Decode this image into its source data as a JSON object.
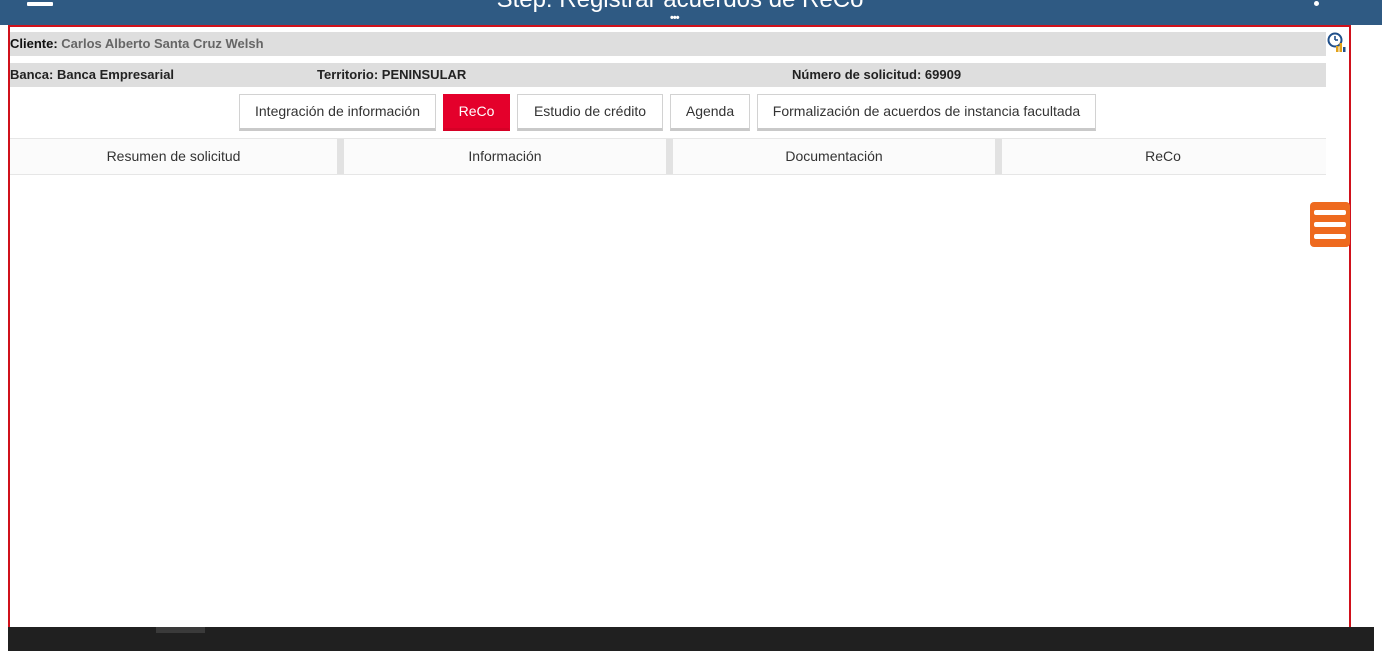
{
  "header": {
    "title": "Step: Registrar acuerdos de ReCo",
    "menu_icon": "hamburger-icon",
    "more_icon": "kebab-icon",
    "overflow_icon": "ellipsis-icon",
    "bg_color": "#2f5a83"
  },
  "client_row": {
    "label": "Cliente:",
    "value": "Carlos Alberto Santa Cruz Welsh",
    "icon": "clock-chart-icon"
  },
  "info_row": {
    "banca_label": "Banca:",
    "banca_value": "Banca Empresarial",
    "territorio_label": "Territorio:",
    "territorio_value": "PENINSULAR",
    "solicitud_label": "Número de solicitud:",
    "solicitud_value": "69909"
  },
  "tabs": [
    {
      "label": "Integración de información",
      "active": false
    },
    {
      "label": "ReCo",
      "active": true
    },
    {
      "label": "Estudio de crédito",
      "active": false
    },
    {
      "label": "Agenda",
      "active": false
    },
    {
      "label": "Formalización de acuerdos de instancia facultada",
      "active": false
    }
  ],
  "subtabs": [
    {
      "label": "Resumen de solicitud"
    },
    {
      "label": "Información"
    },
    {
      "label": "Documentación"
    },
    {
      "label": "ReCo"
    }
  ],
  "side_menu": {
    "icon": "menu-list-icon",
    "color": "#ee6a1f"
  },
  "colors": {
    "accent": "#e4002b",
    "frame": "#d0111b"
  }
}
